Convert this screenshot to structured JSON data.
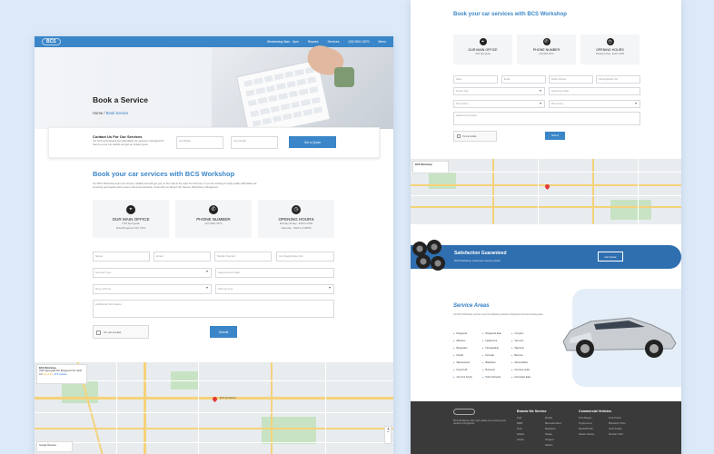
{
  "left": {
    "header": {
      "logo": "BCS",
      "nav": [
        "Wednesday 8am - 6pm",
        "Repairs",
        "Services",
        "(03) 9001 0070",
        "Menu"
      ]
    },
    "hero": {
      "title": "Book a Service",
      "crumb_home": "Home",
      "crumb_sep": "/",
      "crumb_current": "Book Service"
    },
    "quote": {
      "title": "Contact Us For Our Services",
      "desc": "For both professional and affordable car services in Ringwood? Send us your car details and get an instant quote",
      "field1": "Car Make",
      "field2": "Car Model",
      "button": "Get a Quote"
    },
    "section": {
      "title": "Book your car services with BCS Workshop",
      "para": "Our BCS Workshop team are honest, reliable and will get you on the road in the right the first time. If you are looking for high quality affordable car servicing and repairs with a warm and personal touch, book with our Mount Car Service Workshop in Ringwood."
    },
    "cards": [
      {
        "icon": "map-marker-icon",
        "title": "OUR MAIN OFFICE",
        "sub1": "7N/5 Springvale",
        "sub2": "Road Ringwood VIC 3170"
      },
      {
        "icon": "phone-icon",
        "title": "PHONE NUMBER",
        "sub1": "(03) 9001 0070",
        "sub2": ""
      },
      {
        "icon": "clock-icon",
        "title": "OPENING HOURS",
        "sub1": "Monday-Friday : 8AM to 6PM",
        "sub2": "Saturday : 9AM to 2:30PM"
      }
    ],
    "form": {
      "name": "Name",
      "email": "Email",
      "mobile": "Mobile Number",
      "rego": "Car Registration No.",
      "service": "Service Type",
      "appt": "Appointment Date",
      "drop": "Drop off time",
      "pick": "Pick up time",
      "info": "Additional Information",
      "captcha": "I'm not a robot",
      "submit": "Submit"
    },
    "map": {
      "title": "BCS Workshop",
      "addr": "7N/5 Springvale Rd, Ringwood VIC 3134",
      "rating": "4.9",
      "reviews": "374 reviews",
      "pin_label": "BCS Workshop",
      "footer": "Google Reviews"
    }
  },
  "right": {
    "section_title": "Book your car services with BCS Workshop",
    "cards": [
      {
        "title": "OUR MAIN OFFICE",
        "sub": "7N/5 Springvale"
      },
      {
        "title": "PHONE NUMBER",
        "sub": "(03) 9001 0070"
      },
      {
        "title": "OPENING HOURS",
        "sub": "Monday-Friday : 8AM to 6PM"
      }
    ],
    "form": {
      "name": "Name",
      "email": "Email",
      "mobile": "Mobile Number",
      "rego": "Car Registration No.",
      "service": "Service Type",
      "appt": "Appointment Date",
      "drop": "Drop off time",
      "pick": "Pick up time",
      "info": "Additional Information",
      "captcha": "I'm not a robot",
      "submit": "Submit"
    },
    "map": {
      "title": "BCS Workshop"
    },
    "banner": {
      "title": "Satisfaction Guaranteed",
      "sub": "BCS Workshop customers service centre",
      "button": "Get Quote"
    },
    "areas": {
      "title": "Service Areas",
      "desc": "Our BCS Workshop services cover the following suburbs in Ringwood and surrounding areas.",
      "items": [
        "Ringwood",
        "Ringwood East",
        "Croydon",
        "Mitcham",
        "Heathmont",
        "Vermont",
        "Bayswater",
        "Nunawading",
        "Wantirna",
        "Kilsyth",
        "Donvale",
        "Boronia",
        "Warranwood",
        "Blackburn",
        "Mooroolbark",
        "Forest Hill",
        "Burwood",
        "Ferntree Gully",
        "Vermont South",
        "Park Orchards",
        "Doncaster East"
      ]
    },
    "footer": {
      "about": "BCS Workshop offer high quality car servicing and repairs in Ringwood.",
      "col1_title": "Brands We Service",
      "col1": [
        "Audi",
        "BMW",
        "Ford",
        "Holden",
        "Honda"
      ],
      "col1b": [
        "Mazda",
        "Mercedes-Benz",
        "Mitsubishi",
        "Nissan",
        "Peugeot",
        "Subaru"
      ],
      "col2_title": "Commercial Vehicles",
      "col2": [
        "Ford Ranger",
        "Toyota HiLux",
        "Mazda BT-50",
        "Nissan Navara"
      ],
      "col2b": [
        "Ford Transit",
        "Mitsubishi Triton",
        "Isuzu D-Max",
        "Renault Trafic"
      ]
    }
  }
}
